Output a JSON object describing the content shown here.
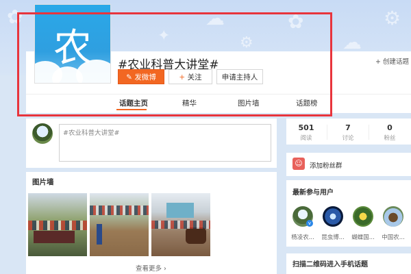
{
  "header": {
    "avatar_char": "农",
    "title": "#农业科普大讲堂#",
    "create_link": "+ 创建话题",
    "buttons": {
      "post": "发微博",
      "follow": "关注",
      "apply_host": "申请主持人"
    },
    "follow_prefix": "+",
    "tabs": [
      "话题主页",
      "精华",
      "图片墙",
      "话题榜"
    ],
    "active_tab": "话题主页"
  },
  "composer": {
    "placeholder": "#农业科普大讲堂#"
  },
  "photo_wall": {
    "title": "图片墙",
    "more": "查看更多 ›"
  },
  "stats": [
    {
      "value": "501",
      "label": "阅读"
    },
    {
      "value": "7",
      "label": "讨论"
    },
    {
      "value": "0",
      "label": "粉丝"
    }
  ],
  "fans_group": {
    "label": "添加粉丝群"
  },
  "recent_users": {
    "title": "最新参与用户",
    "users": [
      "杨凌农...",
      "昆虫博...",
      "蝴蝶国...",
      "中国农..."
    ]
  },
  "qr": {
    "title": "扫描二维码进入手机话题"
  },
  "colors": {
    "accent": "#f26722",
    "highlight_box": "#e8343c",
    "avatar_bg": "#2aa8e8"
  }
}
